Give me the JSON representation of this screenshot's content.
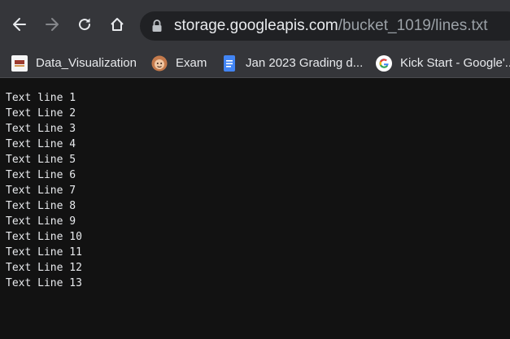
{
  "toolbar": {
    "url_host": "storage.googleapis.com",
    "url_path": "/bucket_1019/lines.txt",
    "back_icon": "arrow-left-icon",
    "forward_icon": "arrow-right-icon",
    "reload_icon": "reload-icon",
    "home_icon": "home-icon",
    "lock_icon": "lock-icon"
  },
  "bookmarks": [
    {
      "label": "Data_Visualization",
      "icon": "site-favicon"
    },
    {
      "label": "Exam",
      "icon": "face-favicon"
    },
    {
      "label": "Jan 2023 Grading d...",
      "icon": "google-docs-icon"
    },
    {
      "label": "Kick Start - Google'...",
      "icon": "google-g-icon"
    }
  ],
  "document": {
    "lines": [
      "Text line 1",
      "Text Line 2",
      "Text Line 3",
      "Text Line 4",
      "Text Line 5",
      "Text Line 6",
      "Text Line 7",
      "Text Line 8",
      "Text Line 9",
      "Text Line 10",
      "Text Line 11",
      "Text Line 12",
      "Text Line 13"
    ]
  },
  "colors": {
    "toolbar_bg": "#35363a",
    "omnibox_bg": "#202124",
    "page_bg": "#121212",
    "text": "#e8eaed"
  }
}
